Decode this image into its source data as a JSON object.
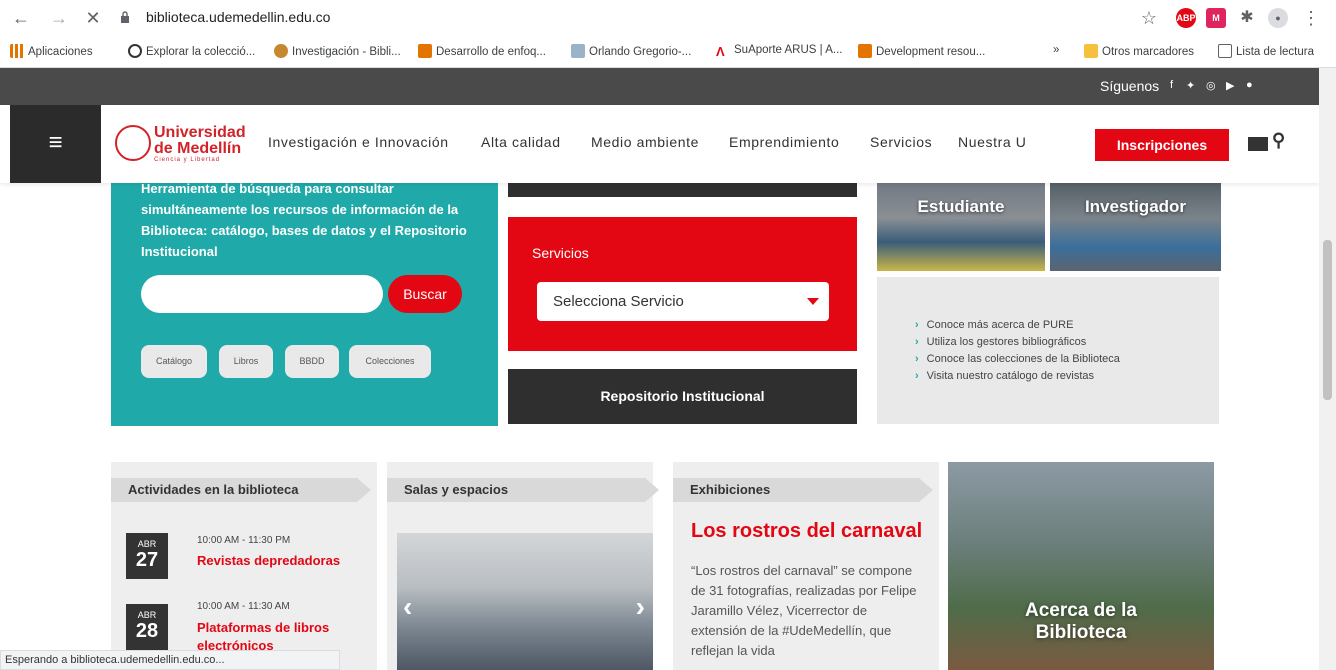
{
  "browser": {
    "url": "biblioteca.udemedellin.edu.co",
    "status_text": "Esperando a biblioteca.udemedellin.edu.co...",
    "bookmarks": [
      "Aplicaciones",
      "Explorar la colecció...",
      "Investigación - Bibli...",
      "Desarrollo de enfoq...",
      "Orlando Gregorio-...",
      "SuAporte ARUS | A...",
      "Development resou..."
    ],
    "more": "»",
    "otros": "Otros marcadores",
    "lectura": "Lista de lectura"
  },
  "topbar": {
    "siguenos": "Síguenos"
  },
  "logo": {
    "line1": "Universidad",
    "line2": "de Medellín",
    "tagline": "Ciencia y Libertad"
  },
  "menu": [
    "Investigación e Innovación",
    "Alta calidad",
    "Medio ambiente",
    "Emprendimiento",
    "Servicios",
    "Nuestra U"
  ],
  "inscripciones": "Inscripciones",
  "search_panel": {
    "description": "Herramienta de búsqueda para consultar simultáneamente los recursos de información de la Biblioteca: catálogo, bases de datos y el Repositorio Institucional",
    "button": "Buscar",
    "filters": [
      "Catálogo",
      "Libros",
      "BBDD",
      "Colecciones"
    ]
  },
  "servicios": {
    "title": "Servicios",
    "selected": "Selecciona Servicio"
  },
  "repositorio": "Repositorio Institucional",
  "photos": {
    "estudiante": "Estudiante",
    "investigador": "Investigador"
  },
  "pure_links": [
    "Conoce más acerca de PURE",
    "Utiliza los gestores bibliográficos",
    "Conoce las colecciones de la Biblioteca",
    "Visita nuestro catálogo de revistas"
  ],
  "actividades": {
    "title": "Actividades en la biblioteca",
    "events": [
      {
        "month": "ABR",
        "day": "27",
        "time": "10:00 AM - 11:30 PM",
        "title": "Revistas depredadoras"
      },
      {
        "month": "ABR",
        "day": "28",
        "time": "10:00 AM - 11:30 AM",
        "title": "Plataformas de libros electrónicos"
      }
    ]
  },
  "salas": {
    "title": "Salas y espacios"
  },
  "exhibiciones": {
    "title": "Exhibiciones",
    "headline": "Los rostros del carnaval",
    "text": "“Los rostros del carnaval” se compone de 31 fotografías, realizadas por Felipe Jaramillo Vélez, Vicerrector de extensión de la #UdeMedellín, que reflejan la vida"
  },
  "acerca": {
    "line1": "Acerca de la",
    "line2": "Biblioteca"
  }
}
